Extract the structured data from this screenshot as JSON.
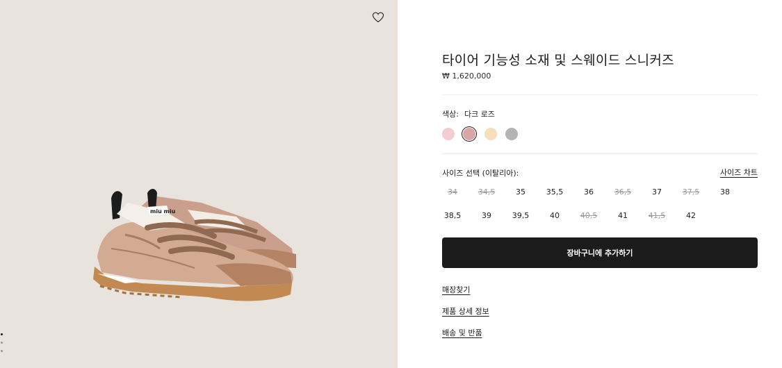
{
  "product": {
    "title": "타이어 기능성 소재 및 스웨이드 스니커즈",
    "price": "₩ 1,620,000",
    "brand_tag": "miu miu"
  },
  "gallery": {
    "wishlist_icon": "heart-icon",
    "slide_count": 3,
    "active_slide": 1
  },
  "color": {
    "label": "색상:",
    "selected": "다크 로즈",
    "swatches": [
      {
        "hex": "#f1cdd3",
        "selected": false
      },
      {
        "hex": "#d9a6a8",
        "selected": true
      },
      {
        "hex": "#f5dfbd",
        "selected": false
      },
      {
        "hex": "#b4b4b4",
        "selected": false
      }
    ]
  },
  "size": {
    "label": "사이즈 선택 (이탈리아):",
    "chart_link": "사이즈 차트",
    "options": [
      {
        "label": "34",
        "available": false
      },
      {
        "label": "34,5",
        "available": false
      },
      {
        "label": "35",
        "available": true
      },
      {
        "label": "35,5",
        "available": true
      },
      {
        "label": "36",
        "available": true
      },
      {
        "label": "36,5",
        "available": false
      },
      {
        "label": "37",
        "available": true
      },
      {
        "label": "37,5",
        "available": false
      },
      {
        "label": "38",
        "available": true
      },
      {
        "label": "38,5",
        "available": true
      },
      {
        "label": "39",
        "available": true
      },
      {
        "label": "39,5",
        "available": true
      },
      {
        "label": "40",
        "available": true
      },
      {
        "label": "40,5",
        "available": false
      },
      {
        "label": "41",
        "available": true
      },
      {
        "label": "41,5",
        "available": false
      },
      {
        "label": "42",
        "available": true
      }
    ]
  },
  "actions": {
    "add_to_cart": "장바구니에 추가하기"
  },
  "links": {
    "store_finder": "매장찾기",
    "product_details": "제품 상세 정보",
    "shipping_returns": "배송 및 반품"
  }
}
